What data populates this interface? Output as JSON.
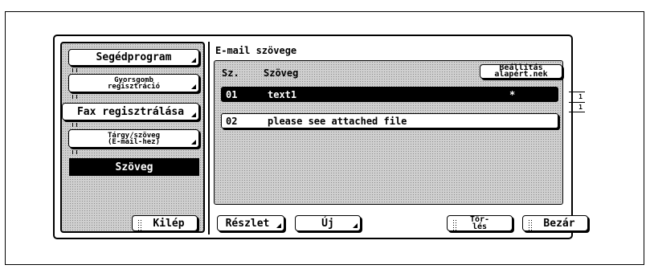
{
  "sidebar": {
    "utility_label": "Segédprogram",
    "speed_dial_line1": "Gyorsgomb",
    "speed_dial_line2": "regisztráció",
    "fax_registration_label": "Fax regisztrálása",
    "subject_text_line1": "Tárgy/szöveg",
    "subject_text_line2": "(E-mail-hez)",
    "text_label": "Szöveg",
    "exit_label": "Kilép"
  },
  "main": {
    "title": "E-mail szövege",
    "header_no": "Sz.",
    "header_text": "Szöveg",
    "default_line1": "Beállítás",
    "default_line2": "alapért.nek",
    "rows": [
      {
        "no": "01",
        "text": "text1",
        "mark": "*"
      },
      {
        "no": "02",
        "text": "please see attached file",
        "mark": ""
      }
    ],
    "page_current": "1",
    "page_total": "1"
  },
  "footer": {
    "details_label": "Részlet",
    "new_label": "Új",
    "delete_line1": "Tör-",
    "delete_line2": "lés",
    "close_label": "Bezár"
  }
}
